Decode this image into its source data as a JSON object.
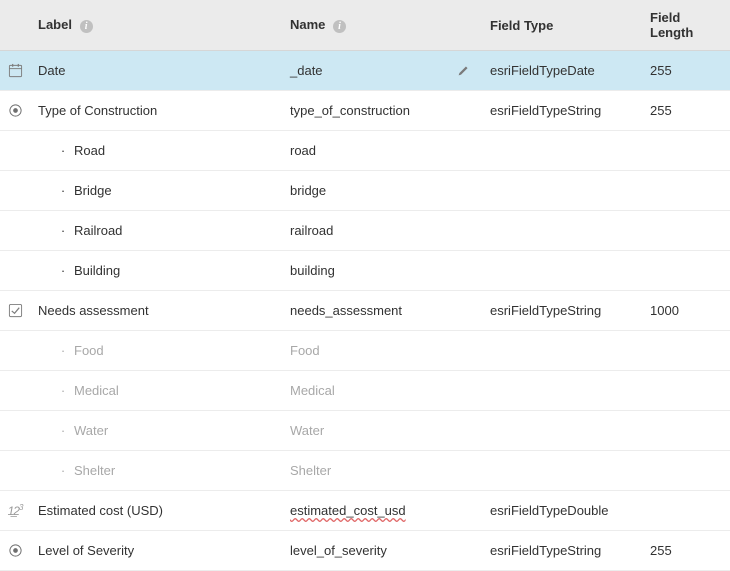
{
  "columns": {
    "label": "Label",
    "name": "Name",
    "fieldType": "Field Type",
    "fieldLength": "Field Length"
  },
  "rows": [
    {
      "icon": "calendar-icon",
      "label": "Date",
      "name": "_date",
      "fieldType": "esriFieldTypeDate",
      "fieldLength": "255",
      "selected": true,
      "editable": true
    },
    {
      "icon": "radio-icon",
      "label": "Type of Construction",
      "name": "type_of_construction",
      "fieldType": "esriFieldTypeString",
      "fieldLength": "255",
      "children": [
        {
          "label": "Road",
          "name": "road"
        },
        {
          "label": "Bridge",
          "name": "bridge"
        },
        {
          "label": "Railroad",
          "name": "railroad"
        },
        {
          "label": "Building",
          "name": "building"
        }
      ]
    },
    {
      "icon": "checkbox-icon",
      "label": "Needs assessment",
      "name": "needs_assessment",
      "fieldType": "esriFieldTypeString",
      "fieldLength": "1000",
      "children": [
        {
          "label": "Food",
          "name": "Food",
          "muted": true
        },
        {
          "label": "Medical",
          "name": "Medical",
          "muted": true
        },
        {
          "label": "Water",
          "name": "Water",
          "muted": true
        },
        {
          "label": "Shelter",
          "name": "Shelter",
          "muted": true
        }
      ]
    },
    {
      "icon": "numeric-icon",
      "label": "Estimated cost (USD)",
      "name": "estimated_cost_usd",
      "fieldType": "esriFieldTypeDouble",
      "fieldLength": "",
      "nameSquiggle": true
    },
    {
      "icon": "radio-icon",
      "label": "Level of Severity",
      "name": "level_of_severity",
      "fieldType": "esriFieldTypeString",
      "fieldLength": "255"
    }
  ]
}
